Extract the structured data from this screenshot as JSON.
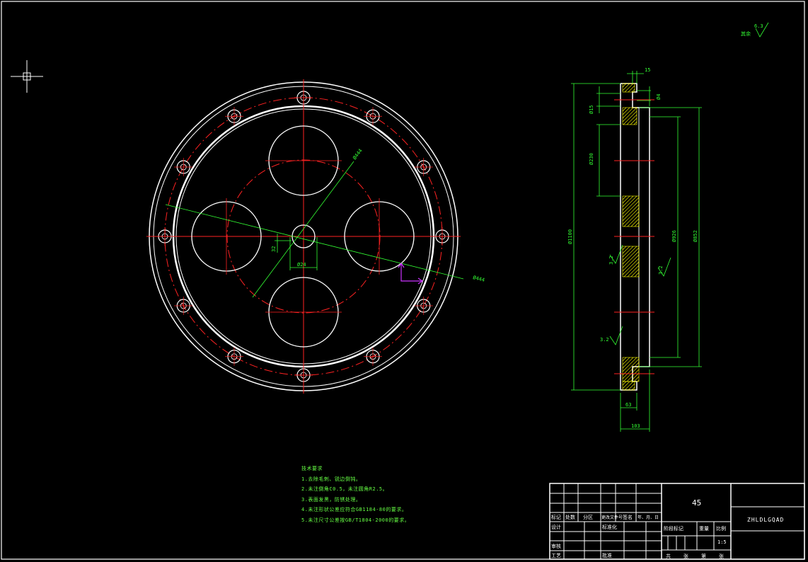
{
  "colors": {
    "background": "#000000",
    "outline": "#ffffff",
    "centerline": "#ff2222",
    "dimension": "#33ff33",
    "section": "#ffff00",
    "ucs": "#cc33ff"
  },
  "front_view": {
    "dims": {
      "bolt_pcd": "Ø444",
      "hub_hole": "Ø24",
      "keyway": "32",
      "outer": "Ø444"
    }
  },
  "side_view": {
    "dims": {
      "top_width": "15",
      "step": "Ø4",
      "small_hole": "Ø15",
      "big_hole": "Ø230",
      "outer_dia": "Ø1100",
      "inner_dia": "Ø926",
      "boss_dia": "Ø852",
      "thickness": "63",
      "overall_width": "103",
      "rough_1": "3.2",
      "rough_2": "3.2",
      "rough_3": "3.2"
    }
  },
  "surface_note": {
    "label": "其余",
    "value": "6.3"
  },
  "technical_requirements": {
    "title": "技术要求",
    "items": [
      "1.去除毛刺、锐边倒钝。",
      "2.未注倒角C0.5，未注圆角R2.5。",
      "3.表面发黑，防锈处理。",
      "4.未注形状公差应符合GB1184-80的要求。",
      "5.未注尺寸公差按GB/T1804-2000的要求。"
    ]
  },
  "title_block": {
    "material": "45",
    "drawing_no": "ZHLDLGQAD",
    "header_labels": [
      "标记",
      "处数",
      "分区",
      "更改文件号",
      "签名",
      "年、月、日"
    ],
    "row_labels": [
      "设计",
      "标准化",
      "审核",
      "工艺",
      "批准"
    ],
    "stage_label": "阶段标记",
    "weight_label": "重量",
    "scale_label": "比例",
    "scale": "1:5",
    "sheet_labels": [
      "共",
      "张",
      "第",
      "张"
    ]
  }
}
